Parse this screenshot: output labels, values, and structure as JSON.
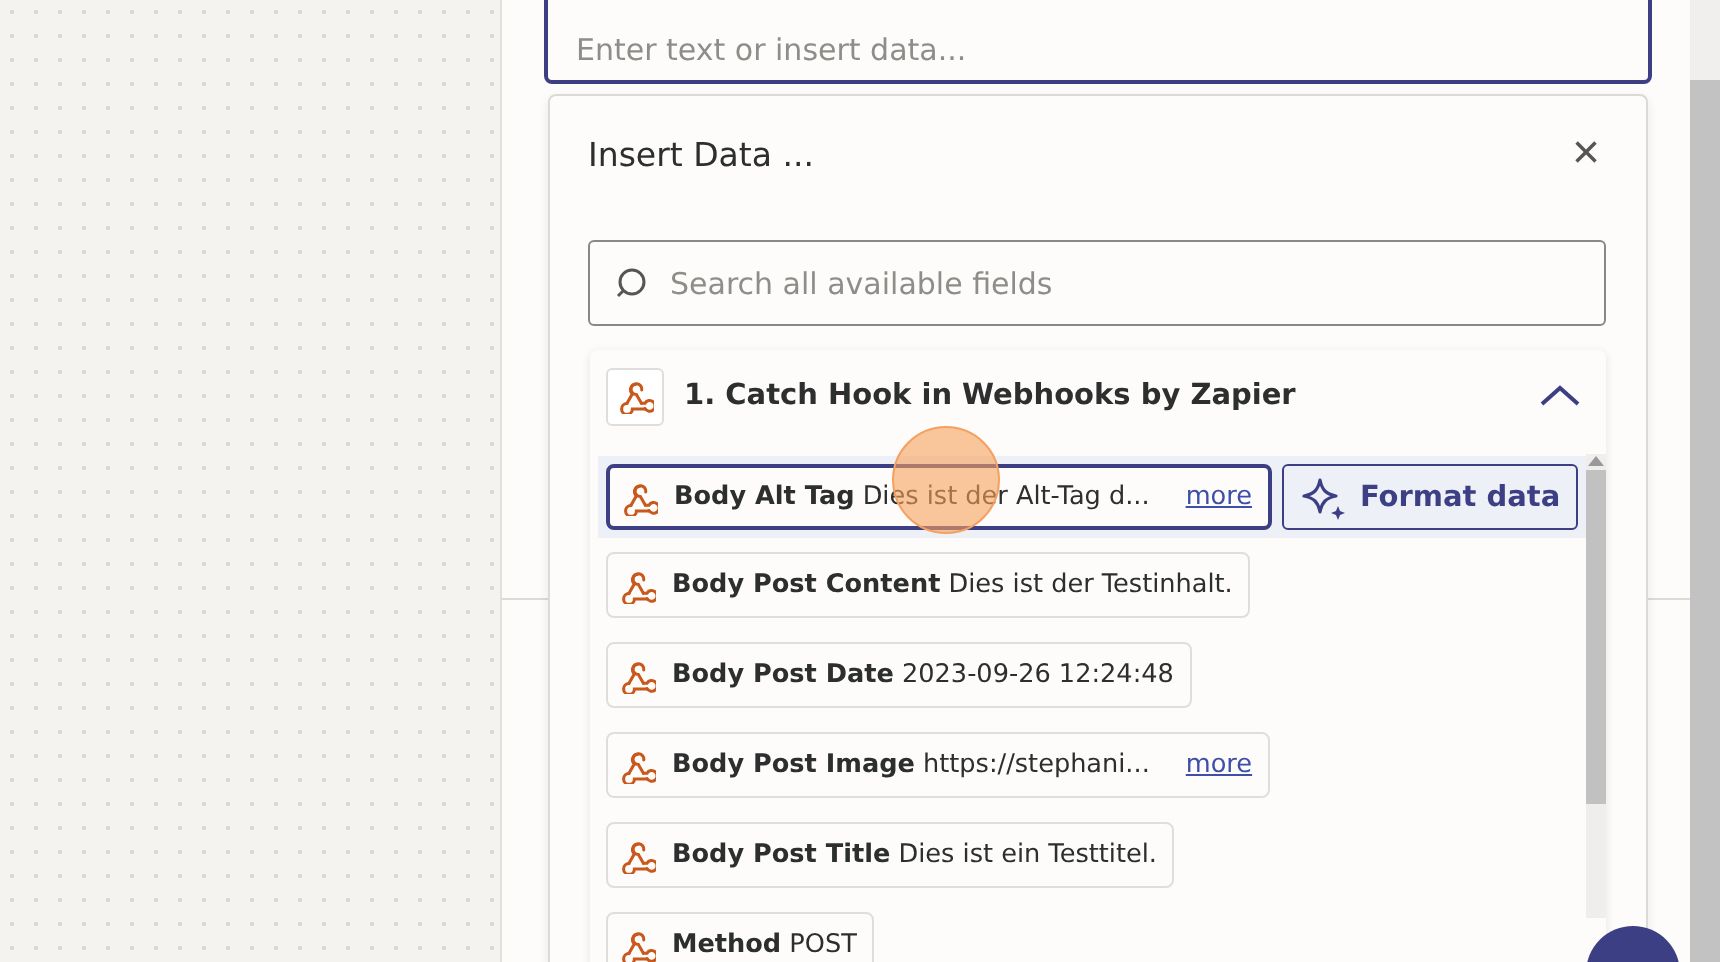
{
  "text_field": {
    "placeholder": "Enter text or insert data..."
  },
  "insert_data": {
    "title": "Insert Data ...",
    "close": "×",
    "search": {
      "placeholder": "Search all available fields"
    },
    "step": {
      "title": "1. Catch Hook in Webhooks by Zapier",
      "expanded": true,
      "fields": [
        {
          "label": "Body Alt Tag",
          "value": "Dies ist der Alt-Tag d...",
          "more": "more",
          "selected": true
        },
        {
          "label": "Body Post Content",
          "value": "Dies ist der Testinhalt.",
          "selected": false
        },
        {
          "label": "Body Post Date",
          "value": "2023-09-26 12:24:48",
          "selected": false
        },
        {
          "label": "Body Post Image",
          "value": "https://stephani...",
          "more": "more",
          "selected": false
        },
        {
          "label": "Body Post Title",
          "value": "Dies ist ein Testtitel.",
          "selected": false
        },
        {
          "label": "Method",
          "value": "POST",
          "selected": false
        }
      ],
      "format_button": "Format data"
    }
  }
}
